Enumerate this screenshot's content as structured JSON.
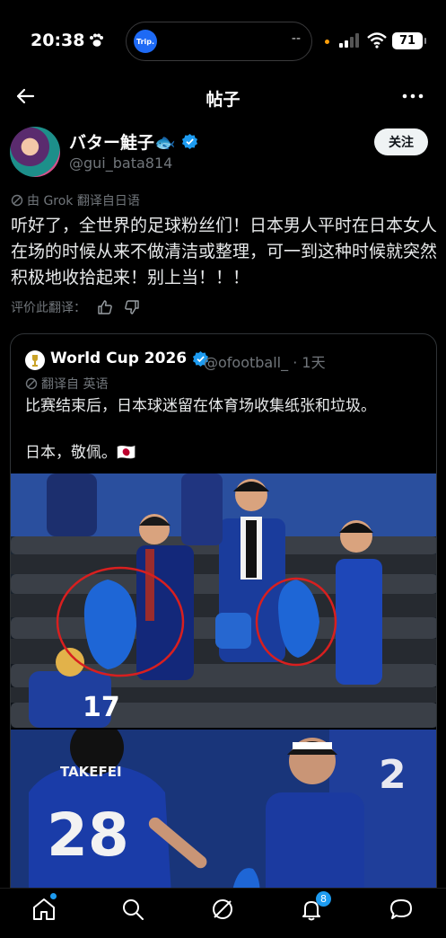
{
  "status_bar": {
    "time": "20:38",
    "island_app": "Trip.",
    "island_text": "--",
    "battery": "71"
  },
  "header": {
    "title": "帖子"
  },
  "author": {
    "name": "バター鮭子🐟",
    "handle": "@gui_bata814",
    "follow_label": "关注"
  },
  "translation_note": "由 Grok 翻译自日语",
  "post_text": "听好了，全世界的足球粉丝们！日本男人平时在日本女人在场的时候从来不做清洁或整理，可一到这种时候就突然积极地收拾起来！别上当！！！",
  "rate_label": "评价此翻译：",
  "quote": {
    "name": "World Cup 2026",
    "handle": "@ofootball_ · 1天",
    "translation_note": "翻译自 英语",
    "text": "比赛结束后，日本球迷留在体育场收集纸张和垃圾。\n\n日本，敬佩。🇯🇵",
    "photo1_jersey_left": "17",
    "photo2_jersey_name": "TAKEFEI",
    "photo2_jersey_number": "28",
    "photo2_jersey_back": "2"
  },
  "tabbar": {
    "notifications_count": "8"
  },
  "colors": {
    "accent": "#1d9bf0",
    "background": "#000000",
    "muted": "#71767b",
    "highlight_circle": "#d81f1f"
  }
}
